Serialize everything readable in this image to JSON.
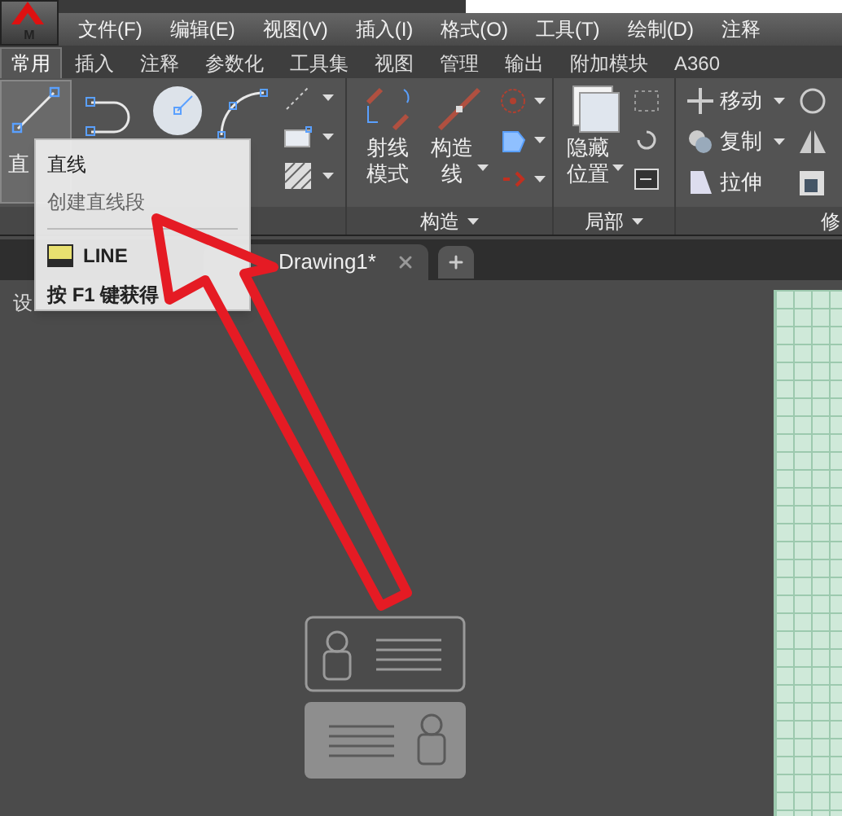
{
  "app_button": {
    "label": "M"
  },
  "menu": [
    "文件(F)",
    "编辑(E)",
    "视图(V)",
    "插入(I)",
    "格式(O)",
    "工具(T)",
    "绘制(D)",
    "注释"
  ],
  "ribbon_tabs": [
    {
      "label": "常用",
      "selected": true
    },
    {
      "label": "插入",
      "selected": false
    },
    {
      "label": "注释",
      "selected": false
    },
    {
      "label": "参数化",
      "selected": false
    },
    {
      "label": "工具集",
      "selected": false
    },
    {
      "label": "视图",
      "selected": false
    },
    {
      "label": "管理",
      "selected": false
    },
    {
      "label": "输出",
      "selected": false
    },
    {
      "label": "附加模块",
      "selected": false
    },
    {
      "label": "A360",
      "selected": false
    }
  ],
  "draw_panel": {
    "line_button": {
      "label": "直",
      "selected": true
    }
  },
  "construct_panel": {
    "title": "构造",
    "buttons": [
      {
        "lines": [
          "射线",
          "模式"
        ],
        "dropdown": false
      },
      {
        "lines": [
          "构造",
          "线"
        ],
        "dropdown": true
      }
    ]
  },
  "local_panel": {
    "title": "局部",
    "buttons": [
      {
        "lines": [
          "隐藏",
          "位置"
        ],
        "dropdown": true
      }
    ]
  },
  "modify_panel": {
    "title": "修",
    "tools": [
      {
        "label": "移动",
        "dropdown": true
      },
      {
        "label": "复制",
        "dropdown": true
      },
      {
        "label": "拉伸",
        "dropdown": false
      }
    ]
  },
  "doc_tabs": [
    {
      "label": "Drawing1*",
      "selected": true
    }
  ],
  "viewport": {
    "label": "设"
  },
  "tooltip": {
    "title": "直线",
    "description": "创建直线段",
    "command": "LINE",
    "help": "按 F1 键获得"
  }
}
